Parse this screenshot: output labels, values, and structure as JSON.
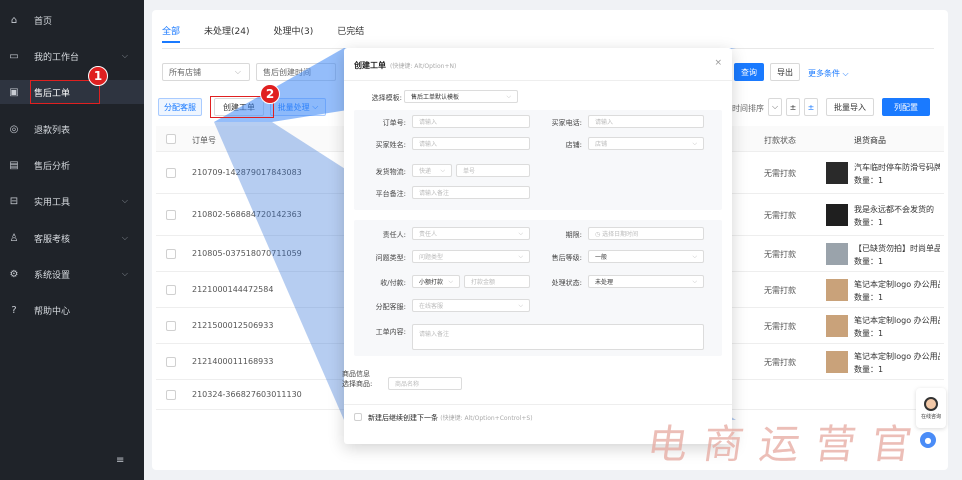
{
  "sidebar": {
    "items": [
      {
        "label": "首页",
        "icon": "home-icon",
        "glyph": "⌂",
        "chevron": false
      },
      {
        "label": "我的工作台",
        "icon": "monitor-icon",
        "glyph": "▭",
        "chevron": true
      },
      {
        "label": "售后工单",
        "icon": "clipboard-icon",
        "glyph": "▣",
        "chevron": false,
        "active": true
      },
      {
        "label": "退款列表",
        "icon": "refund-icon",
        "glyph": "◎",
        "chevron": false
      },
      {
        "label": "售后分析",
        "icon": "report-icon",
        "glyph": "▤",
        "chevron": false
      },
      {
        "label": "实用工具",
        "icon": "toolbox-icon",
        "glyph": "⊟",
        "chevron": true
      },
      {
        "label": "客服考核",
        "icon": "people-icon",
        "glyph": "♙",
        "chevron": true
      },
      {
        "label": "系统设置",
        "icon": "settings-icon",
        "glyph": "⚙",
        "chevron": true
      },
      {
        "label": "帮助中心",
        "icon": "help-icon",
        "glyph": "?",
        "chevron": false
      }
    ],
    "collapse_glyph": "≡"
  },
  "tabs": [
    "全部",
    "未处理(24)",
    "处理中(3)",
    "已完结"
  ],
  "filters": {
    "shop": "所有店铺",
    "date": "售后创建时间"
  },
  "toolbar": {
    "assign_label": "分配客服",
    "create_label": "创建工单",
    "batch_label": "批量处理",
    "sort_label": "时间排序",
    "query_label": "查询",
    "export_label": "导出",
    "more_label": "更多条件",
    "import_label": "批量导入",
    "columns_label": "列配置"
  },
  "table": {
    "headers": {
      "order": "订单号",
      "print": "打款状态",
      "goods": "退货商品"
    },
    "rows": [
      {
        "order": "210709-142879017843083",
        "status": "无需打款",
        "goods": "汽车临时停车防滑号码牌",
        "qty": "数量：1"
      },
      {
        "order": "210802-568684720142363",
        "status": "无需打款",
        "goods": "我是永远都不会发货的",
        "qty": "数量：1"
      },
      {
        "order": "210805-037518070711059",
        "status": "无需打款",
        "goods": "【已缺货勿拍】时尚单品",
        "qty": "数量：1"
      },
      {
        "order": "2121000144472584",
        "status": "无需打款",
        "goods": "笔记本定制logo 办公用品",
        "qty": "数量：1"
      },
      {
        "order": "2121500012506933",
        "status": "无需打款",
        "goods": "笔记本定制logo 办公用品",
        "qty": "数量：1"
      },
      {
        "order": "2121400011168933",
        "status": "无需打款",
        "goods": "笔记本定制logo 办公用品",
        "qty": "数量：1"
      },
      {
        "order": "210324-366827603011130",
        "status": "",
        "goods": "",
        "qty": ""
      }
    ]
  },
  "modal": {
    "title": "创建工单",
    "hint": "(快捷键: Alt/Option+N)",
    "close": "×",
    "template_label": "选择模板:",
    "template_value": "售后工单默认模板",
    "order_label": "订单号:",
    "order_ph": "请输入",
    "phone_label": "买家电话:",
    "phone_ph": "请输入",
    "buyer_label": "买家姓名:",
    "buyer_ph": "请输入",
    "shop_label": "店铺:",
    "shop_ph": "店铺",
    "logistics_label": "发货物流:",
    "logistics_ph": "快递",
    "tracking_ph": "单号",
    "remark_label": "平台备注:",
    "remark_ph": "请输入备注",
    "owner_label": "责任人:",
    "owner_ph": "责任人",
    "deadline_label": "期限:",
    "deadline_ph": "◷ 选择日期时间",
    "issue_label": "问题类型:",
    "issue_ph": "问题类型",
    "level_label": "售后等级:",
    "level_value": "一般",
    "pay_label": "收/付款:",
    "pay_value": "小额打款",
    "amount_ph": "打款金额",
    "status_label": "处理状态:",
    "status_value": "未处理",
    "agent_label": "分配客服:",
    "agent_ph": "在线客服",
    "content_label": "工单内容:",
    "content_ph": "请输入备注",
    "goods_section": "商品信息",
    "goods_label": "选择商品:",
    "goods_ph": "商品名称",
    "continue_label": "新建后继续创建下一条",
    "continue_hint": "(快捷键: Alt/Option+Control+S)"
  },
  "annotations": {
    "step1": "1",
    "step2": "2"
  },
  "watermark": "电商运营官",
  "float_help": "在线咨询",
  "colors": {
    "accent": "#1a7aff",
    "sidebar": "#1f2329",
    "marker": "#e02020"
  }
}
